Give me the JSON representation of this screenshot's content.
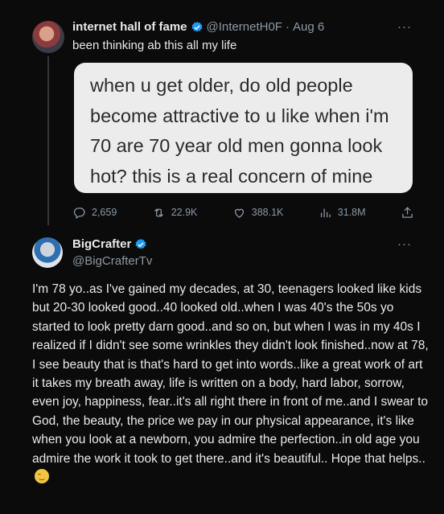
{
  "tweet1": {
    "display_name": "internet hall of fame",
    "handle": "@InternetH0F",
    "separator": "·",
    "date": "Aug 6",
    "more": "···",
    "text": "been thinking ab this all my life",
    "image_text": "when u get older, do old people become attractive to u like when i'm 70 are 70 year old men gonna look hot? this is a real concern of mine",
    "stats": {
      "replies": "2,659",
      "retweets": "22.9K",
      "likes": "388.1K",
      "views": "31.8M"
    }
  },
  "tweet2": {
    "display_name": "BigCrafter",
    "handle": "@BigCrafterTv",
    "more": "···",
    "text": "I'm 78 yo..as I've gained my decades, at 30, teenagers looked like kids but 20-30 looked good..40 looked old..when I was 40's the 50s yo started to look pretty darn good..and so on, but when I was in my 40s I realized if I didn't see some wrinkles they didn't look finished..now at 78, I see beauty that is that's hard to get into words..like a great work of art it takes my breath away, life is written on a body, hard labor, sorrow, even joy, happiness, fear..it's all right there in front of me..and I swear to God,  the beauty, the price we pay in our physical appearance, it's like when you look at a newborn, you admire the perfection..in old age you admire the work it took to get there..and it's beautiful.. Hope that helps.."
  },
  "colors": {
    "background": "#0b0b0b",
    "verified": "#1d9bf0",
    "muted": "#8b98a5",
    "image_bg": "#ececec"
  },
  "icons": {
    "verified": "verified-badge-icon",
    "reply": "reply-icon",
    "retweet": "retweet-icon",
    "like": "heart-icon",
    "views": "views-chart-icon",
    "share": "share-icon",
    "emoji": "relieved-face-emoji"
  }
}
